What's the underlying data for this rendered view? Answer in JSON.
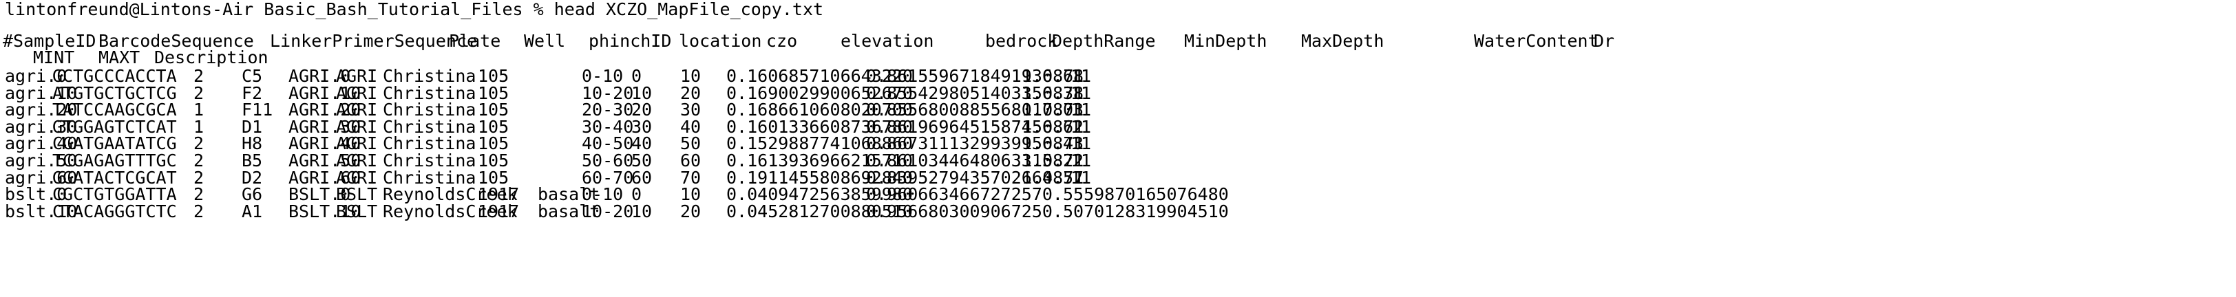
{
  "terminal": {
    "prompt_line": "lintonfreund@Lintons-Air Basic_Bash_Tutorial_Files % head XCZO_MapFile_copy.txt",
    "header": {
      "row1": [
        "#SampleID",
        "BarcodeSequence",
        "LinkerPrimerSequence",
        "Plate",
        "Well",
        "phinchID",
        "location",
        "czo",
        "elevation",
        "bedrock",
        "DepthRange",
        "MinDepth",
        "MaxDepth",
        "WaterContent",
        "Dr"
      ],
      "row2": [
        "MINT",
        "MAXT",
        "Description"
      ]
    },
    "rows": [
      [
        "agri.0",
        "GCTGCCCACCTA",
        "2",
        "C5",
        "AGRI.0",
        "AGRI",
        "Christina",
        "105",
        "",
        "0-10",
        "0",
        "10",
        "0.1606857106643220",
        "0.8615596718491936.68",
        "1.0871",
        "11"
      ],
      [
        "agri.10",
        "ATGTGCTGCTCG",
        "2",
        "F2",
        "AGRI.10",
        "AGRI",
        "Christina",
        "105",
        "",
        "10-20",
        "10",
        "20",
        "0.1690029900652670",
        "0.8554298051403356.38",
        "1.0871",
        "11"
      ],
      [
        "agri.20",
        "TATCCAAGCGCA",
        "1",
        "F11",
        "AGRI.20",
        "AGRI",
        "Christina",
        "105",
        "",
        "20-30",
        "20",
        "30",
        "0.1686610608020700",
        "0.8556800885568017.03",
        "1.0871",
        "11"
      ],
      [
        "agri.30",
        "GTGGAGTCTCAT",
        "1",
        "D1",
        "AGRI.30",
        "AGRI",
        "Christina",
        "105",
        "",
        "30-40",
        "30",
        "40",
        "0.1601336608736780",
        "0.8619696451587456.62",
        "1.0871",
        "11"
      ],
      [
        "agri.40",
        "CGATGAATATCG",
        "2",
        "H8",
        "AGRI.40",
        "AGRI",
        "Christina",
        "105",
        "",
        "40-50",
        "40",
        "50",
        "0.1529887741068860",
        "0.8673111329939956.43",
        "1.0871",
        "11"
      ],
      [
        "agri.50",
        "TCGAGAGTTTGC",
        "2",
        "B5",
        "AGRI.50",
        "AGRI",
        "Christina",
        "105",
        "",
        "50-60",
        "50",
        "60",
        "0.1613936966215710",
        "0.8610344648063315.22",
        "1.0871",
        "11"
      ],
      [
        "agri.60",
        "GGATACTCGCAT",
        "2",
        "D2",
        "AGRI.60",
        "AGRI",
        "Christina",
        "105",
        "",
        "60-70",
        "60",
        "70",
        "0.1911455808692840",
        "0.8395279435702664.57",
        "1.0871",
        "11"
      ],
      [
        "bslt.0",
        "CGCTGTGGATTA",
        "2",
        "G6",
        "BSLT.0",
        "BSLT",
        "ReynoldsCreek",
        "1917",
        "basalt",
        "0-10",
        "0",
        "10",
        "0.0409472563859980",
        "0.9606634667272570.5559870165076480",
        "",
        ""
      ],
      [
        "bslt.10",
        "CTACAGGGTCTC",
        "2",
        "A1",
        "BSLT.10",
        "BSLT",
        "ReynoldsCreek",
        "1917",
        "basalt",
        "10-20",
        "10",
        "20",
        "0.0452812700880510",
        "0.9566803009067250.5070128319904510",
        "",
        ""
      ]
    ]
  }
}
